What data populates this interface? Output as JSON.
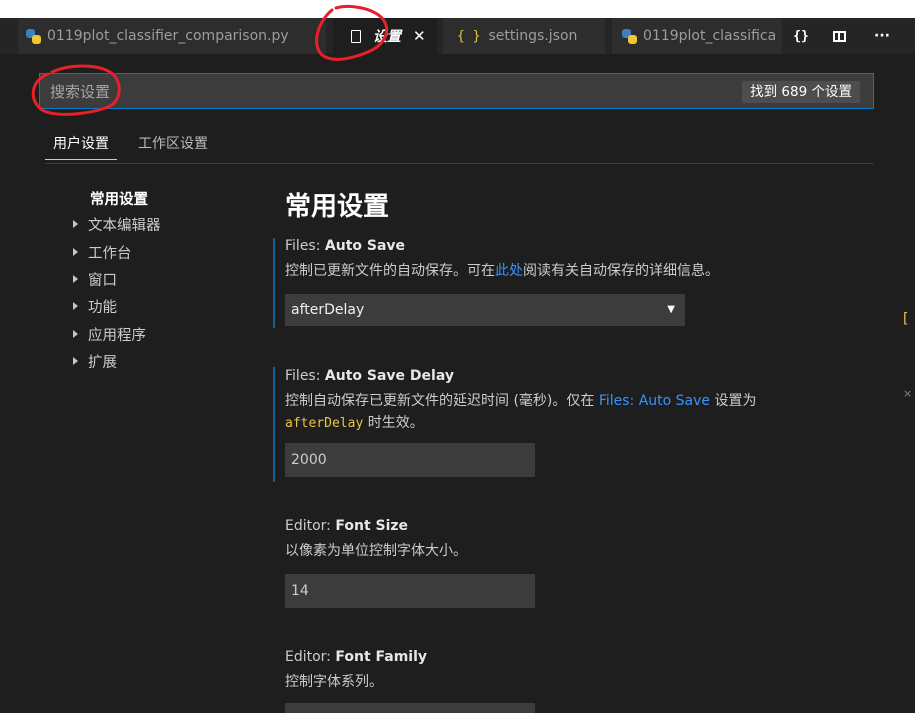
{
  "tabs": [
    {
      "label": "0119plot_classifier_comparison.py",
      "icon": "python-icon"
    },
    {
      "label": "设置",
      "icon": "file-icon",
      "close": "✕"
    },
    {
      "label": "settings.json",
      "icon": "braces-icon"
    },
    {
      "label": "0119plot_classifica",
      "icon": "python-icon"
    }
  ],
  "tab_actions": {
    "json": "{}",
    "more": "···"
  },
  "search": {
    "placeholder": "搜索设置",
    "count": "找到 689 个设置"
  },
  "scope_tabs": [
    "用户设置",
    "工作区设置"
  ],
  "toc": {
    "header": "常用设置",
    "items": [
      "文本编辑器",
      "工作台",
      "窗口",
      "功能",
      "应用程序",
      "扩展"
    ]
  },
  "section_title": "常用设置",
  "settings": [
    {
      "category": "Files: ",
      "name": "Auto Save",
      "desc_pre": "控制已更新文件的自动保存。可在",
      "desc_link": "此处",
      "desc_post": "阅读有关自动保存的详细信息。",
      "value": "afterDelay",
      "arrow": "▼"
    },
    {
      "category": "Files: ",
      "name": "Auto Save Delay",
      "desc_pre": "控制自动保存已更新文件的延迟时间 (毫秒)。仅在 ",
      "desc_link": "Files: Auto Save",
      "desc_post": " 设置为",
      "desc_code": "afterDelay",
      "desc_tail": " 时生效。",
      "value": "2000"
    },
    {
      "category": "Editor: ",
      "name": "Font Size",
      "desc": "以像素为单位控制字体大小。",
      "value": "14"
    },
    {
      "category": "Editor: ",
      "name": "Font Family",
      "desc": "控制字体系列。"
    }
  ],
  "edge_marks": [
    "[",
    "×"
  ],
  "colors": {
    "accent": "#007acc",
    "link": "#3794ff",
    "annotation": "#e8202a"
  }
}
